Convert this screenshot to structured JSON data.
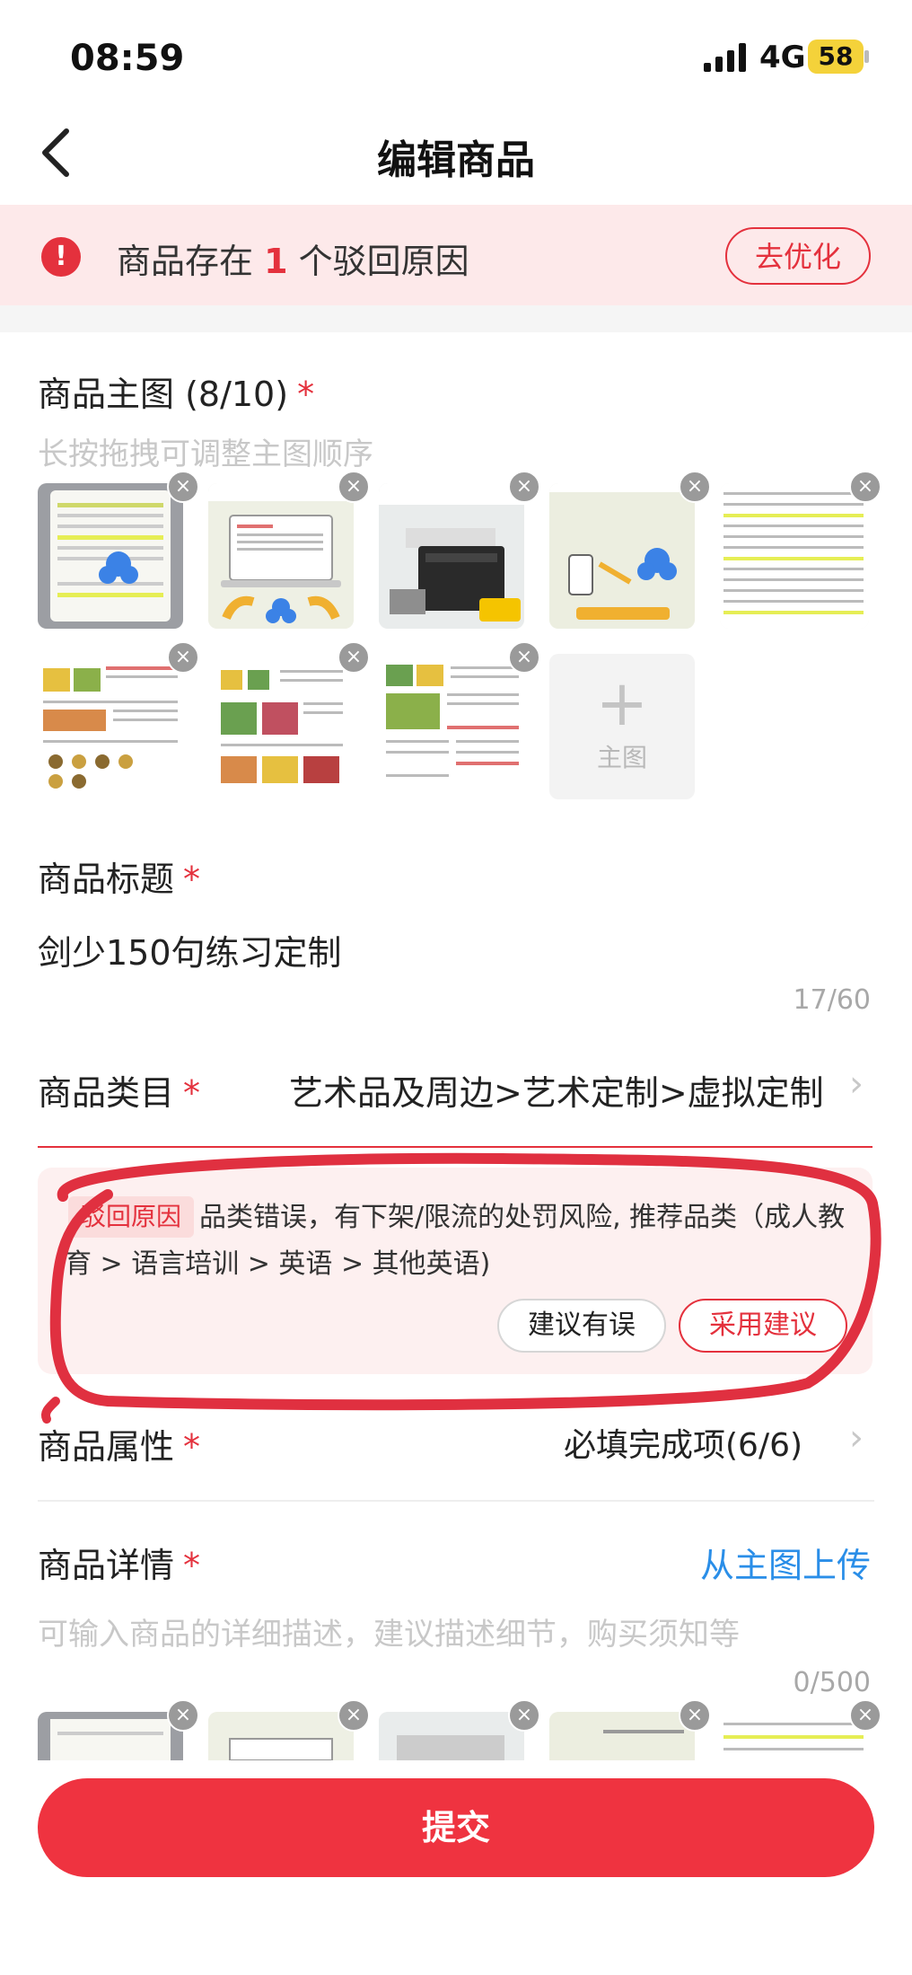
{
  "status_bar": {
    "time": "08:59",
    "network": "4G",
    "battery": "58"
  },
  "nav": {
    "title": "编辑商品"
  },
  "banner": {
    "prefix": "商品存在",
    "count": "1",
    "suffix": "个驳回原因",
    "action": "去优化"
  },
  "main_images": {
    "label": "商品主图 (8/10)",
    "required_mark": "*",
    "hint": "长按拖拽可调整主图顺序",
    "add_label": "主图",
    "add_icon": "plus-icon",
    "close_glyph": "×"
  },
  "title_field": {
    "label": "商品标题",
    "required_mark": "*",
    "value": "剑少150句练习定制",
    "counter": "17/60"
  },
  "category": {
    "label": "商品类目",
    "required_mark": "*",
    "value": "艺术品及周边>艺术定制>虚拟定制",
    "reject_tag": "驳回原因",
    "reject_text": "品类错误，有下架/限流的处罚风险, 推荐品类（成人教育 > 语言培训 > 英语 > 其他英语)",
    "btn_wrong": "建议有误",
    "btn_adopt": "采用建议"
  },
  "attributes": {
    "label": "商品属性",
    "required_mark": "*",
    "value": "必填完成项(6/6)"
  },
  "details": {
    "label": "商品详情",
    "required_mark": "*",
    "upload_link": "从主图上传",
    "placeholder": "可输入商品的详细描述，建议描述细节，购买须知等",
    "counter": "0/500"
  },
  "submit": {
    "label": "提交"
  },
  "colors": {
    "accent": "#e4313d",
    "submit_bg": "#ef3340",
    "link": "#2a8ee8",
    "banner_bg": "#fde9ea",
    "annotation": "#e03040"
  }
}
